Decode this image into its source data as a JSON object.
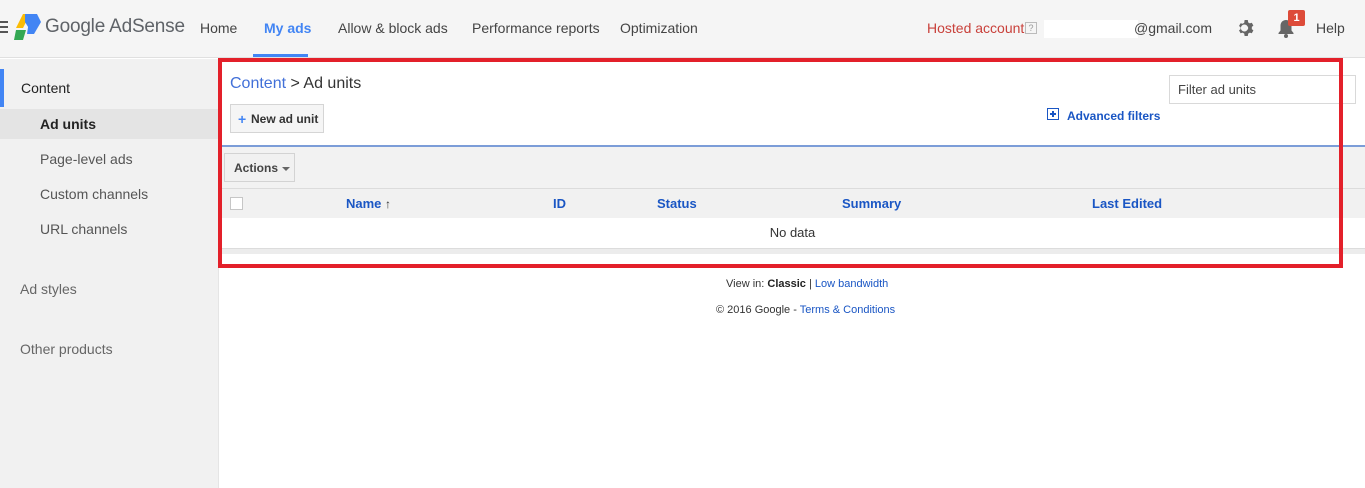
{
  "header": {
    "brand": "Google AdSense",
    "nav": [
      "Home",
      "My ads",
      "Allow & block ads",
      "Performance reports",
      "Optimization"
    ],
    "active_nav": "My ads",
    "hosted_account": "Hosted account",
    "hosted_help": "?",
    "email": "@gmail.com",
    "notification_count": "1",
    "help": "Help"
  },
  "sidebar": {
    "section_title": "Content",
    "items": [
      "Ad units",
      "Page-level ads",
      "Custom channels",
      "URL channels"
    ],
    "selected_item": "Ad units",
    "ad_styles": "Ad styles",
    "other_products": "Other products"
  },
  "main": {
    "breadcrumb_link": "Content",
    "breadcrumb_sep": " > ",
    "breadcrumb_current": "Ad units",
    "new_ad_unit_plus": "+",
    "new_ad_unit": "New ad unit",
    "filter_placeholder": "Filter ad units",
    "advanced_filters": "Advanced filters",
    "actions": "Actions",
    "columns": [
      "Name",
      "ID",
      "Status",
      "Summary",
      "Last Edited"
    ],
    "sort_arrow": "↑",
    "empty_text": "No data"
  },
  "footer": {
    "view_in": "View in:",
    "classic": "Classic",
    "separator": "|",
    "low_bandwidth": "Low bandwidth",
    "copyright": "© 2016 Google -",
    "terms": "Terms & Conditions"
  },
  "colors": {
    "accent": "#4285f4",
    "link": "#1a56c4",
    "hosted": "#c9413b",
    "highlight_frame": "#e3202a",
    "badge": "#dd4b39"
  }
}
